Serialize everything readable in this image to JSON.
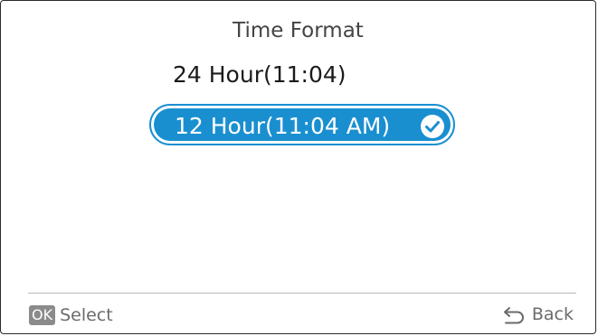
{
  "screen": {
    "title": "Time Format"
  },
  "options": [
    {
      "label": "24 Hour(11:04)",
      "selected": false
    },
    {
      "label": "12 Hour(11:04 AM)",
      "selected": true
    }
  ],
  "footer": {
    "ok_badge": "OK",
    "select_label": "Select",
    "back_label": "Back",
    "back_icon": "return-arrow-icon",
    "check_icon": "checkmark-circle-icon"
  },
  "colors": {
    "accent": "#1a8fd0",
    "text": "#1b1b1b",
    "muted": "#6b6b6b",
    "badge": "#8b8b8b"
  }
}
